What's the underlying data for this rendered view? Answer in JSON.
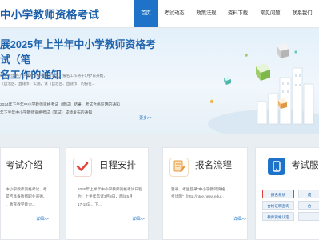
{
  "header": {
    "site_title": "中小学教师资格考试",
    "nav": [
      "首页",
      "考试动态",
      "政策法规",
      "资料下载",
      "常见问题",
      "联系我们"
    ]
  },
  "hero": {
    "title_lines": [
      "展2025年上半年中小学教师资格考试（笔",
      "名工作的通知"
    ],
    "summary_lines": [
      "年上半年中小学教师资格考试（笔试）报名工作将于1月7日开始，",
      "（自治区、直辖市）实施，请（自治区、直辖市）的报名..."
    ],
    "news": [
      "2024年下半年中小学教师资格考试（面试）结果、考试合格证明的通知",
      "年下半年中小学教师资格考试（笔试）成绩发布的通知"
    ],
    "more": "更多>>"
  },
  "cards": {
    "intro": {
      "title": "考试介绍",
      "text": [
        "中小学教师资格考试、考",
        "是否具备教师职业道德、",
        "、教育教学能力..."
      ],
      "more": "详细>>"
    },
    "schedule": {
      "title": "日程安排",
      "text": [
        "2025年上半年中小学教师资格考试日程",
        "为：上半年笔试3月8日，面试5月",
        "17-18日。下..."
      ],
      "more": "详细>>"
    },
    "registration": {
      "title": "报名流程",
      "text": [
        "登录、考生登录\"中小学教师资格",
        "考试网\"（http://ntce.neea.edu..."
      ],
      "more": "详细>>"
    },
    "service": {
      "title": "考试服务",
      "buttons": [
        "报名系统",
        "成",
        "合格证明查询",
        "合",
        "教师资格认定",
        ""
      ]
    }
  },
  "colors": {
    "brand_blue": "#1e73c8",
    "title_blue": "#1f64ad",
    "highlight_red": "#e0443c"
  }
}
